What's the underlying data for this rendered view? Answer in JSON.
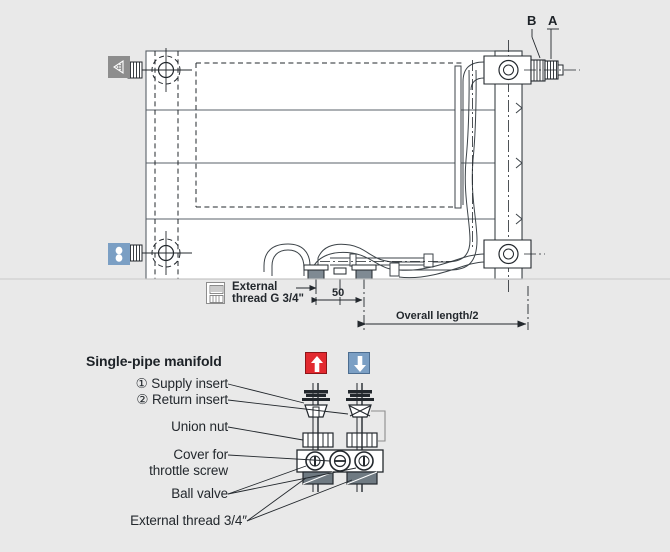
{
  "document": {
    "type": "technical-line-drawing",
    "subject": "Radiator with single-pipe manifold valve connection",
    "background_color": "#e9e9e9",
    "line_color": "#23282d"
  },
  "upper_drawing": {
    "title": "",
    "connection_labels": [
      {
        "id": "B",
        "text": "B"
      },
      {
        "id": "A",
        "text": "A"
      }
    ],
    "annotations": {
      "external_thread": {
        "line1": "External",
        "line2": "thread G 3/4\""
      },
      "dimension_50": "50",
      "overall_length": "Overall length/2"
    },
    "icons": [
      {
        "name": "air-vent-icon",
        "color": "#8d8d8d"
      },
      {
        "name": "drain-valve-icon",
        "color": "#7b9fc4"
      },
      {
        "name": "external-thread-icon",
        "color": "#ffffff"
      }
    ]
  },
  "lower_detail": {
    "heading": "Single-pipe manifold",
    "flow_indicators": [
      {
        "name": "supply-flow-arrow",
        "direction": "up",
        "color": "#e2292f"
      },
      {
        "name": "return-flow-arrow",
        "direction": "down",
        "color": "#7b9fc4"
      }
    ],
    "callouts": [
      {
        "marker": "①",
        "label": "Supply insert"
      },
      {
        "marker": "②",
        "label": "Return insert"
      },
      {
        "marker": "",
        "label": "Union nut"
      },
      {
        "marker": "",
        "label": "Cover for",
        "label2": "throttle screw"
      },
      {
        "marker": "",
        "label": "Ball valve"
      },
      {
        "marker": "",
        "label": "External thread 3/4″"
      }
    ]
  }
}
